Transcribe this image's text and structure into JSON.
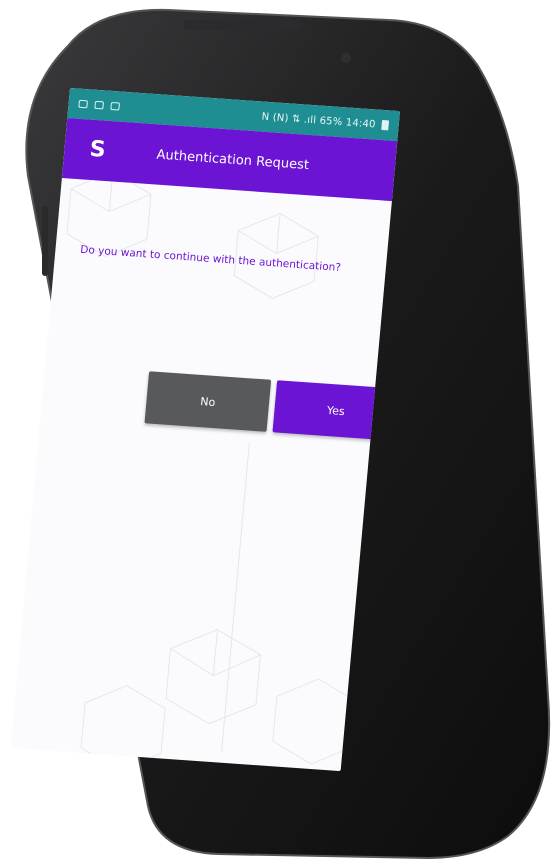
{
  "status_bar": {
    "left_icons": [
      "image-icon",
      "app-icon",
      "message-icon"
    ],
    "right_text": "N (N) ⇅ .ıll 65% 14:40",
    "time": "14:40"
  },
  "app_bar": {
    "logo_icon": "brand-logo-icon",
    "title": "Authentication Request"
  },
  "dialog": {
    "question": "Do you want to continue with the authentication?",
    "no_label": "No",
    "yes_label": "Yes"
  },
  "colors": {
    "accent": "#6c14d4",
    "status_bar": "#1f8e93",
    "no_button": "#58595b",
    "background": "#fbfbfd"
  }
}
